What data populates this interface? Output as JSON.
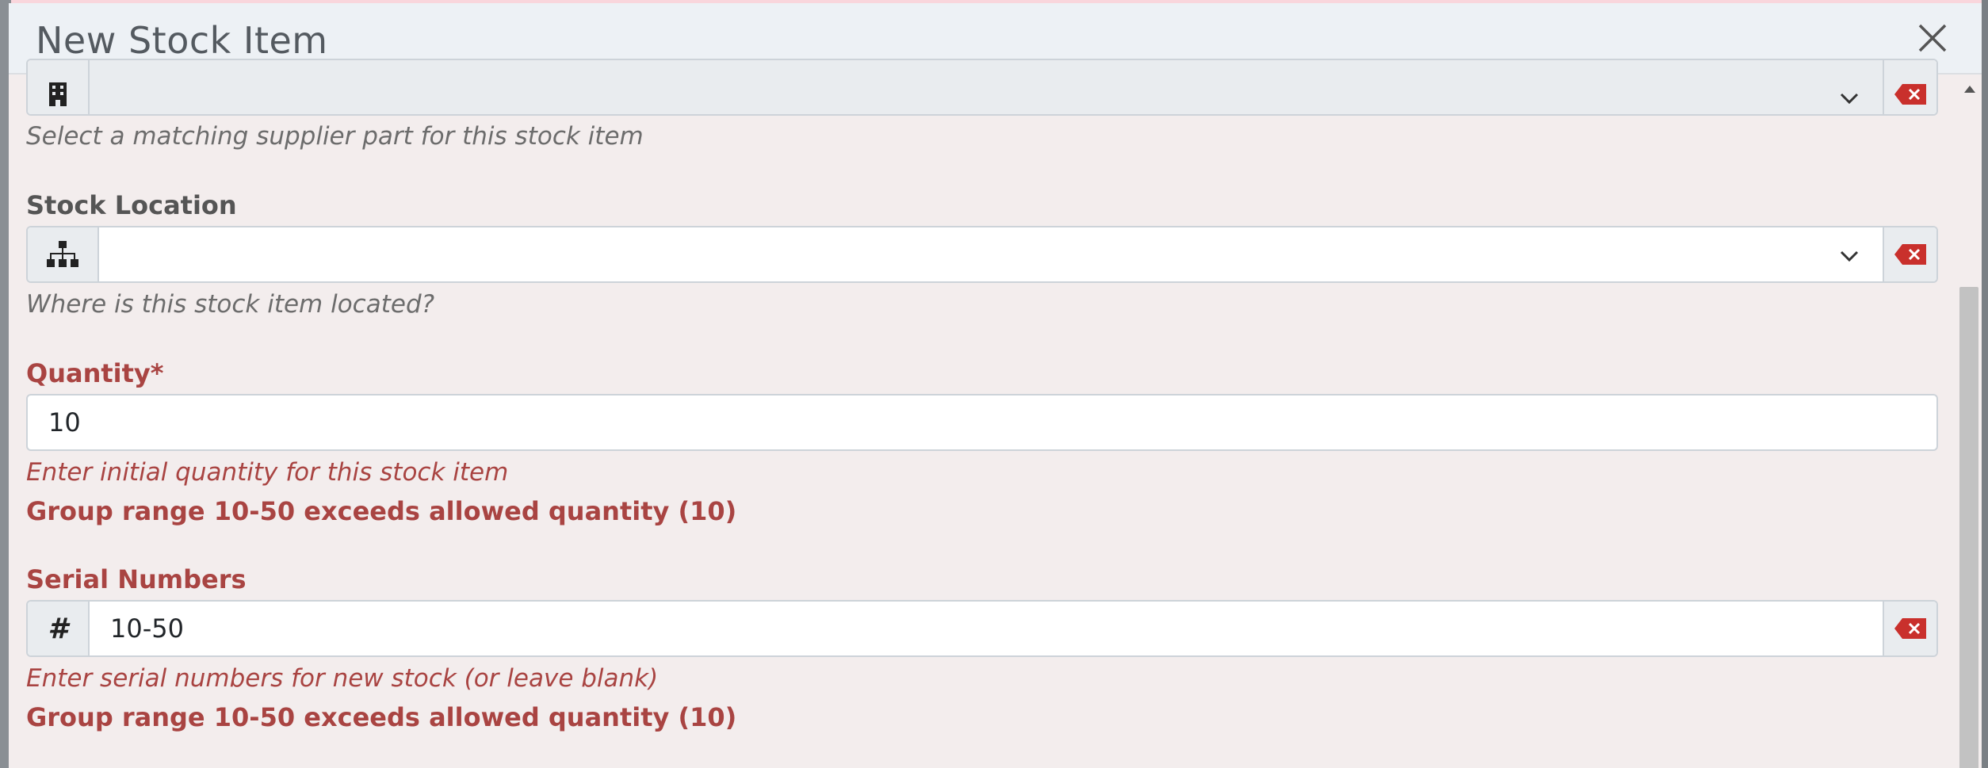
{
  "modal": {
    "title": "New Stock Item"
  },
  "supplier_part": {
    "icon": "building-icon",
    "value": "",
    "help": "Select a matching supplier part for this stock item"
  },
  "stock_location": {
    "label": "Stock Location",
    "icon": "sitemap-icon",
    "value": "",
    "help": "Where is this stock item located?"
  },
  "quantity": {
    "label": "Quantity*",
    "value": "10",
    "help": "Enter initial quantity for this stock item",
    "error": "Group range 10-50 exceeds allowed quantity (10)"
  },
  "serial_numbers": {
    "label": "Serial Numbers",
    "icon": "hash-icon",
    "icon_glyph": "#",
    "value": "10-50",
    "help": "Enter serial numbers for new stock (or leave blank)",
    "error": "Group range 10-50 exceeds allowed quantity (10)"
  },
  "colors": {
    "error": "#a94442",
    "clear_icon": "#c9302c",
    "header_bg": "#edf1f5",
    "body_bg": "#f3eded"
  }
}
